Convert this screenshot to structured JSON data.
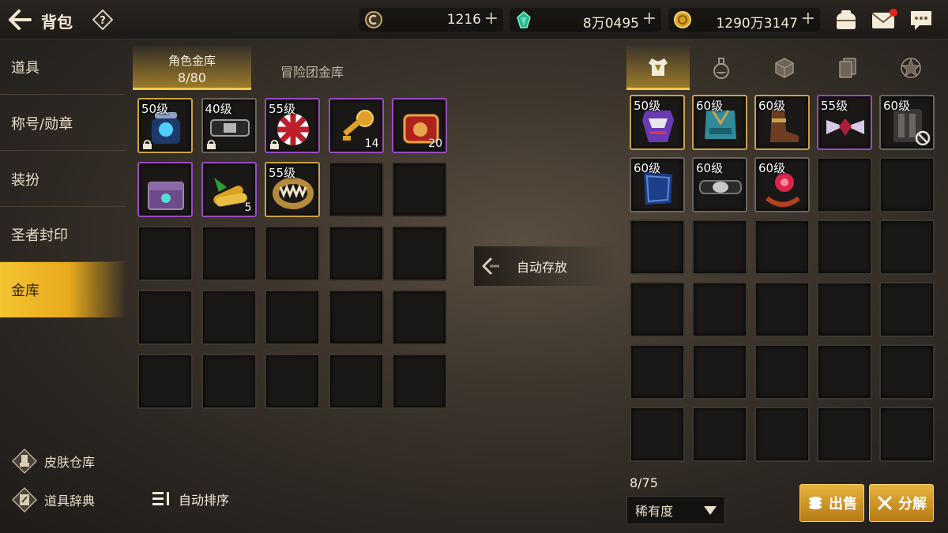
{
  "header": {
    "title": "背包",
    "currencies": [
      {
        "icon": "silver-coin-icon",
        "value": "1216"
      },
      {
        "icon": "green-gem-icon",
        "value": "8万0495"
      },
      {
        "icon": "gold-coin-icon",
        "value": "1290万3147"
      }
    ],
    "plus": "+"
  },
  "sidebar": {
    "items": [
      {
        "label": "道具"
      },
      {
        "label": "称号/勋章"
      },
      {
        "label": "装扮"
      },
      {
        "label": "圣者封印"
      },
      {
        "label": "金库"
      }
    ],
    "bottom": [
      {
        "label": "皮肤仓库",
        "icon": "skin-storage-icon"
      },
      {
        "label": "道具辞典",
        "icon": "item-dictionary-icon"
      }
    ]
  },
  "left_tabs": {
    "character": {
      "label": "角色金库",
      "count": "8/80"
    },
    "team": {
      "label": "冒险团金库"
    }
  },
  "left_items": [
    {
      "level": "50级",
      "rarity": "gold",
      "locked": true,
      "count": "",
      "art": "blue-bag"
    },
    {
      "level": "40级",
      "rarity": "gray",
      "locked": true,
      "count": "",
      "art": "belt"
    },
    {
      "level": "55级",
      "rarity": "purple",
      "locked": true,
      "count": "",
      "art": "checker-orb"
    },
    {
      "level": "",
      "rarity": "purple",
      "locked": false,
      "count": "14",
      "art": "golden-key"
    },
    {
      "level": "",
      "rarity": "purple",
      "locked": false,
      "count": "20",
      "art": "red-scroll"
    },
    {
      "level": "",
      "rarity": "purple",
      "locked": false,
      "count": "",
      "art": "chest"
    },
    {
      "level": "",
      "rarity": "purple",
      "locked": false,
      "count": "5",
      "art": "scrolls-bundle"
    },
    {
      "level": "55级",
      "rarity": "gold",
      "locked": false,
      "count": "",
      "art": "fang-ring"
    }
  ],
  "sort_button": "自动排序",
  "auto_store": "自动存放",
  "right_tabs": [
    "armor-tab-icon",
    "potion-tab-icon",
    "cube-tab-icon",
    "card-tab-icon",
    "emblem-tab-icon"
  ],
  "right_items": [
    {
      "level": "50级",
      "rarity": "gold",
      "art": "purple-armor",
      "blocked": false
    },
    {
      "level": "60级",
      "rarity": "gold",
      "art": "teal-armor",
      "blocked": false
    },
    {
      "level": "60级",
      "rarity": "gold",
      "art": "boots",
      "blocked": false
    },
    {
      "level": "55级",
      "rarity": "purple",
      "art": "winged-gem",
      "blocked": false
    },
    {
      "level": "60级",
      "rarity": "gray",
      "art": "dark-gear",
      "blocked": true
    },
    {
      "level": "60级",
      "rarity": "gray",
      "art": "blue-shield",
      "blocked": false
    },
    {
      "level": "60级",
      "rarity": "gray",
      "art": "dark-belt",
      "blocked": false
    },
    {
      "level": "60级",
      "rarity": "gray",
      "art": "red-ring",
      "blocked": false
    }
  ],
  "right_count": "8/75",
  "sort_select": "稀有度",
  "buttons": {
    "sell": "出售",
    "decompose": "分解"
  },
  "colors": {
    "accent": "#f1c84b",
    "gold_button": "#e9b23c"
  }
}
